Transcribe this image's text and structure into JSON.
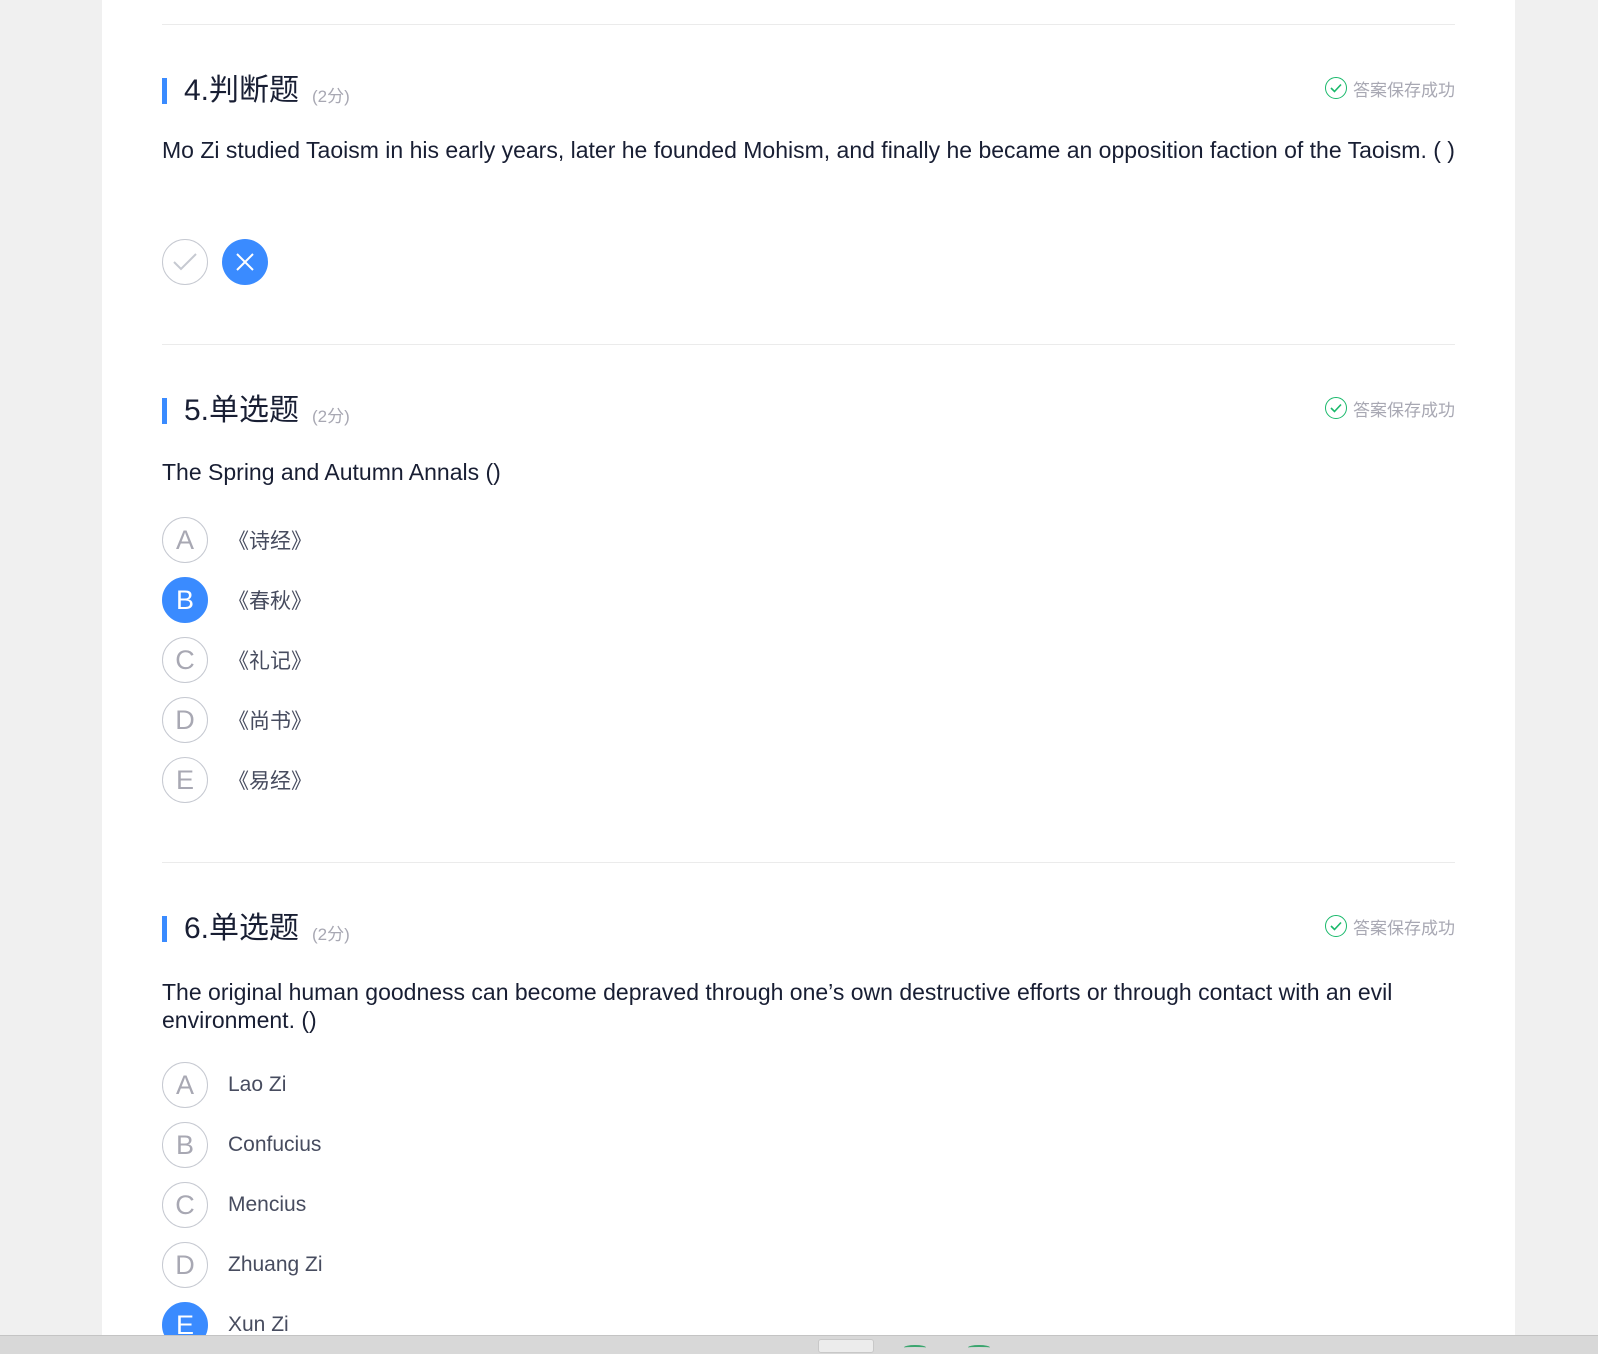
{
  "questions": [
    {
      "title": "4.判断题",
      "score": "(2分)",
      "status": "答案保存成功",
      "text": "Mo Zi studied Taoism in his early years, later he founded Mohism, and finally he became an opposition faction of the Taoism. ( )",
      "answer": "false"
    },
    {
      "title": "5.单选题",
      "score": "(2分)",
      "status": "答案保存成功",
      "text": "The Spring and Autumn Annals ()",
      "options": [
        {
          "letter": "A",
          "label": "《诗经》"
        },
        {
          "letter": "B",
          "label": "《春秋》"
        },
        {
          "letter": "C",
          "label": "《礼记》"
        },
        {
          "letter": "D",
          "label": "《尚书》"
        },
        {
          "letter": "E",
          "label": "《易经》"
        }
      ],
      "selected": "B"
    },
    {
      "title": "6.单选题",
      "score": "(2分)",
      "status": "答案保存成功",
      "text": "The original human goodness can become depraved through one’s own destructive efforts or through contact with an evil environment. ()",
      "options": [
        {
          "letter": "A",
          "label": "Lao Zi"
        },
        {
          "letter": "B",
          "label": "Confucius"
        },
        {
          "letter": "C",
          "label": "Mencius"
        },
        {
          "letter": "D",
          "label": "Zhuang Zi"
        },
        {
          "letter": "E",
          "label": "Xun Zi"
        }
      ],
      "selected": "E"
    }
  ],
  "colors": {
    "accent": "#3a8bff",
    "success": "#19b96b",
    "muted": "#a8a8b3",
    "text": "#181e33"
  }
}
